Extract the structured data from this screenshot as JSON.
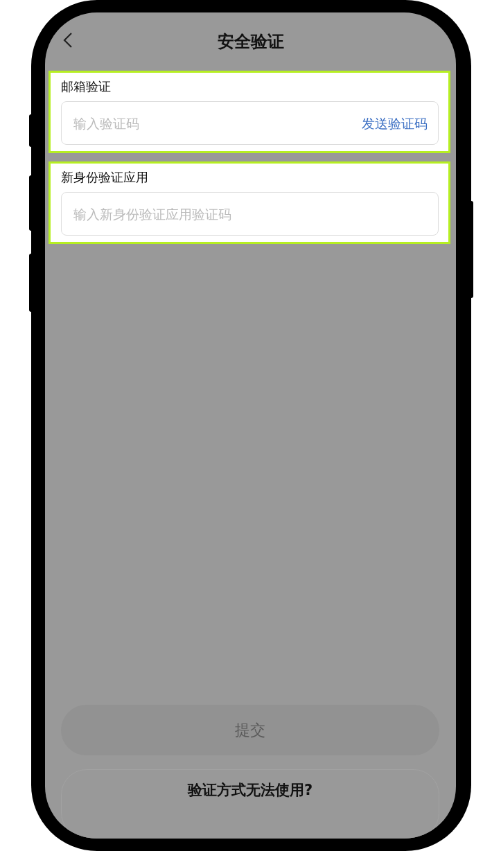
{
  "header": {
    "title": "安全验证"
  },
  "sections": [
    {
      "label": "邮箱验证",
      "placeholder": "输入验证码",
      "action": "发送验证码",
      "highlighted": true
    },
    {
      "label": "新身份验证应用",
      "placeholder": "输入新身份验证应用验证码",
      "highlighted": true
    }
  ],
  "submit_button": {
    "label": "提交",
    "disabled": true
  },
  "help_button": {
    "label": "验证方式无法使用?"
  }
}
